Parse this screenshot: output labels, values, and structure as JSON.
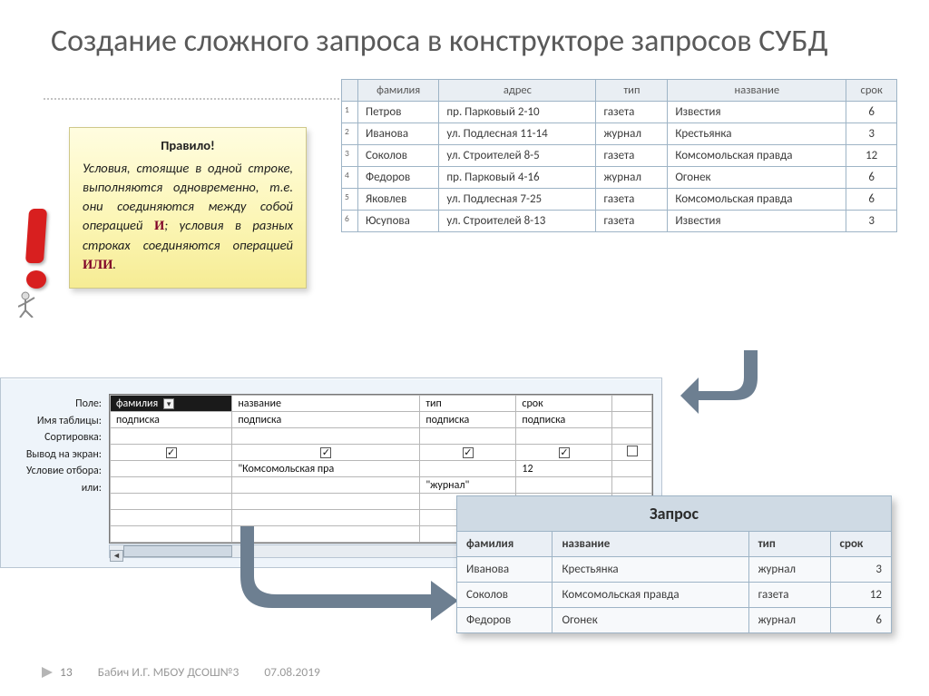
{
  "title": "Создание сложного запроса в конструкторе запросов СУБД",
  "rule": {
    "heading": "Правило!",
    "body_before": "Условия, стоящие в одной строке, выполняются одновременно, т.е. они соединяются между собой операцией ",
    "and": "И",
    "body_mid": "; условия в разных строках соединяются операцией ",
    "or": "ИЛИ",
    "body_after": "."
  },
  "table": {
    "headers": [
      "фамилия",
      "адрес",
      "тип",
      "название",
      "срок"
    ],
    "rows": [
      {
        "n": "1",
        "cells": [
          "Петров",
          "пр. Парковый 2-10",
          "газета",
          "Известия",
          "6"
        ]
      },
      {
        "n": "2",
        "cells": [
          "Иванова",
          "ул. Подлесная 11-14",
          "журнал",
          "Крестьянка",
          "3"
        ]
      },
      {
        "n": "3",
        "cells": [
          "Соколов",
          "ул. Строителей 8-5",
          "газета",
          "Комсомольская правда",
          "12"
        ]
      },
      {
        "n": "4",
        "cells": [
          "Федоров",
          "пр. Парковый 4-16",
          "журнал",
          "Огонек",
          "6"
        ]
      },
      {
        "n": "5",
        "cells": [
          "Яковлев",
          "ул. Подлесная 7-25",
          "газета",
          "Комсомольская правда",
          "6"
        ]
      },
      {
        "n": "6",
        "cells": [
          "Юсупова",
          "ул. Строителей 8-13",
          "газета",
          "Известия",
          "3"
        ]
      }
    ]
  },
  "designer": {
    "labels": [
      "Поле:",
      "Имя таблицы:",
      "Сортировка:",
      "Вывод на экран:",
      "Условие отбора:",
      "или:"
    ],
    "cols": [
      {
        "field": "фамилия",
        "table": "подписка",
        "show": true,
        "crit": "",
        "or": ""
      },
      {
        "field": "название",
        "table": "подписка",
        "show": true,
        "crit": "\"Комсомольская пра",
        "or": ""
      },
      {
        "field": "тип",
        "table": "подписка",
        "show": true,
        "crit": "",
        "or": "\"журнал\""
      },
      {
        "field": "срок",
        "table": "подписка",
        "show": true,
        "crit": "12",
        "or": ""
      }
    ]
  },
  "result": {
    "caption": "Запрос",
    "headers": [
      "фамилия",
      "название",
      "тип",
      "срок"
    ],
    "rows": [
      [
        "Иванова",
        "Крестьянка",
        "журнал",
        "3"
      ],
      [
        "Соколов",
        "Комсомольская правда",
        "газета",
        "12"
      ],
      [
        "Федоров",
        "Огонек",
        "журнал",
        "6"
      ]
    ]
  },
  "footer": {
    "page": "13",
    "author": "Бабич И.Г. МБОУ ДСОШ№3",
    "date": "07.08.2019"
  }
}
